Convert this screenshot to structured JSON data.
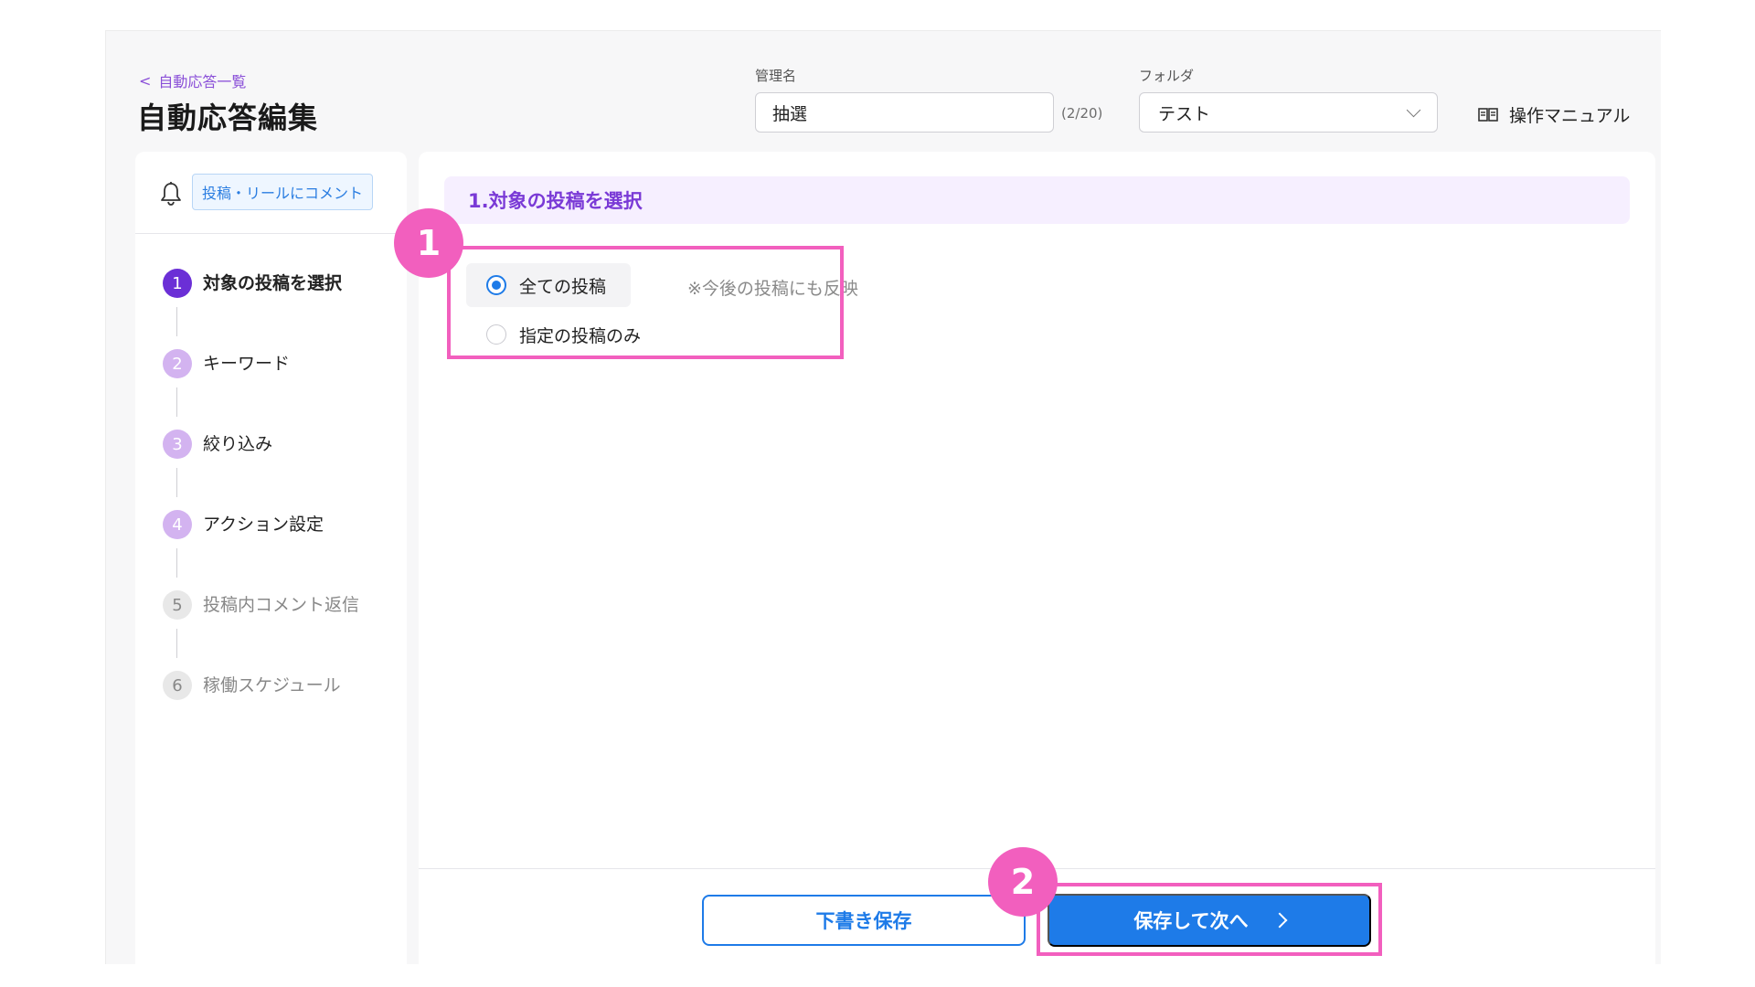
{
  "header": {
    "back_link": "自動応答一覧",
    "title": "自動応答編集",
    "name_label": "管理名",
    "name_value": "抽選",
    "name_counter": "(2/20)",
    "folder_label": "フォルダ",
    "folder_value": "テスト",
    "manual_link": "操作マニュアル"
  },
  "sidebar": {
    "trigger_badge": "投稿・リールにコメント",
    "steps": [
      {
        "num": "1",
        "label": "対象の投稿を選択",
        "state": "active"
      },
      {
        "num": "2",
        "label": "キーワード",
        "state": "todo"
      },
      {
        "num": "3",
        "label": "絞り込み",
        "state": "todo"
      },
      {
        "num": "4",
        "label": "アクション設定",
        "state": "todo"
      },
      {
        "num": "5",
        "label": "投稿内コメント返信",
        "state": "disabled"
      },
      {
        "num": "6",
        "label": "稼働スケジュール",
        "state": "disabled"
      }
    ]
  },
  "main": {
    "section_title": "1.対象の投稿を選択",
    "options": [
      {
        "label": "全ての投稿",
        "note": "※今後の投稿にも反映",
        "selected": true
      },
      {
        "label": "指定の投稿のみ",
        "selected": false
      }
    ],
    "draft_button": "下書き保存",
    "next_button": "保存して次へ"
  },
  "annotations": {
    "badge1": "1",
    "badge2": "2"
  },
  "colors": {
    "primary": "#1e7be8",
    "accent_purple": "#6b2fd6",
    "annotation_pink": "#f25fbe"
  }
}
